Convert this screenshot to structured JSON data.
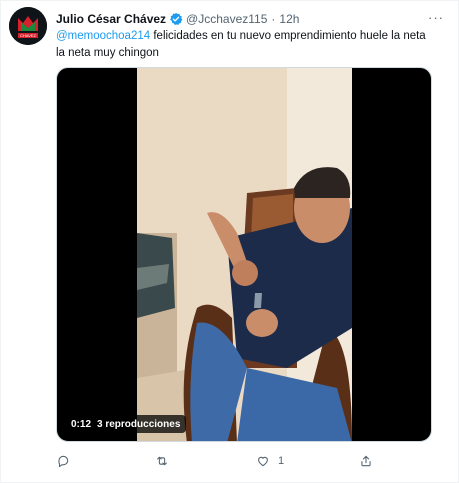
{
  "tweet": {
    "author": {
      "name": "Julio César Chávez",
      "handle": "@Jcchavez115",
      "verified": true,
      "avatar_text": "CHAVEZ"
    },
    "separator": "·",
    "time": "12h",
    "more_label": "···",
    "text": {
      "mention": "@memoochoa214",
      "body": " felicidades en tu nuevo emprendimiento huele la neta la neta muy chingon"
    },
    "video": {
      "duration": "0:12",
      "views": "3 reproducciones"
    },
    "actions": {
      "reply": {
        "icon": "reply-icon",
        "count": ""
      },
      "retweet": {
        "icon": "retweet-icon",
        "count": ""
      },
      "like": {
        "icon": "heart-icon",
        "count": "1"
      },
      "share": {
        "icon": "share-icon",
        "count": ""
      }
    },
    "colors": {
      "accent": "#1d9bf0",
      "secondary_text": "#536471",
      "avatar_red": "#d6202c",
      "avatar_green": "#1b8a3a"
    }
  }
}
